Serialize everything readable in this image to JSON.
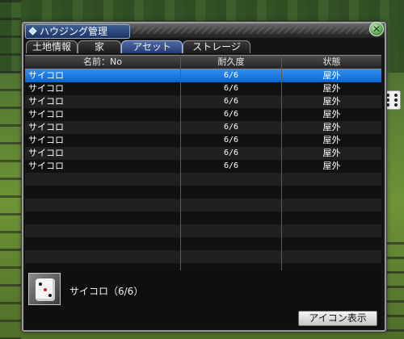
{
  "window": {
    "title": "ハウジング管理",
    "close_label": "✕"
  },
  "tabs": [
    {
      "label": "土地情報"
    },
    {
      "label": "家"
    },
    {
      "label": "アセット",
      "active": true
    },
    {
      "label": "ストレージ"
    }
  ],
  "table": {
    "headers": [
      "名前：No",
      "耐久度",
      "状態"
    ],
    "rows": [
      {
        "name": "サイコロ",
        "durability": "6/6",
        "state": "屋外",
        "selected": true
      },
      {
        "name": "サイコロ",
        "durability": "6/6",
        "state": "屋外"
      },
      {
        "name": "サイコロ",
        "durability": "6/6",
        "state": "屋外"
      },
      {
        "name": "サイコロ",
        "durability": "6/6",
        "state": "屋外"
      },
      {
        "name": "サイコロ",
        "durability": "6/6",
        "state": "屋外"
      },
      {
        "name": "サイコロ",
        "durability": "6/6",
        "state": "屋外"
      },
      {
        "name": "サイコロ",
        "durability": "6/6",
        "state": "屋外"
      },
      {
        "name": "サイコロ",
        "durability": "6/6",
        "state": "屋外"
      }
    ],
    "empty_rows": 9
  },
  "detail": {
    "item_name": "サイコロ（6/6）",
    "icon": "dice-icon",
    "icon_button_label": "アイコン表示"
  },
  "colors": {
    "selected_row": "#1577e0",
    "active_tab": "#3a5591",
    "window_bg": "#141414"
  }
}
